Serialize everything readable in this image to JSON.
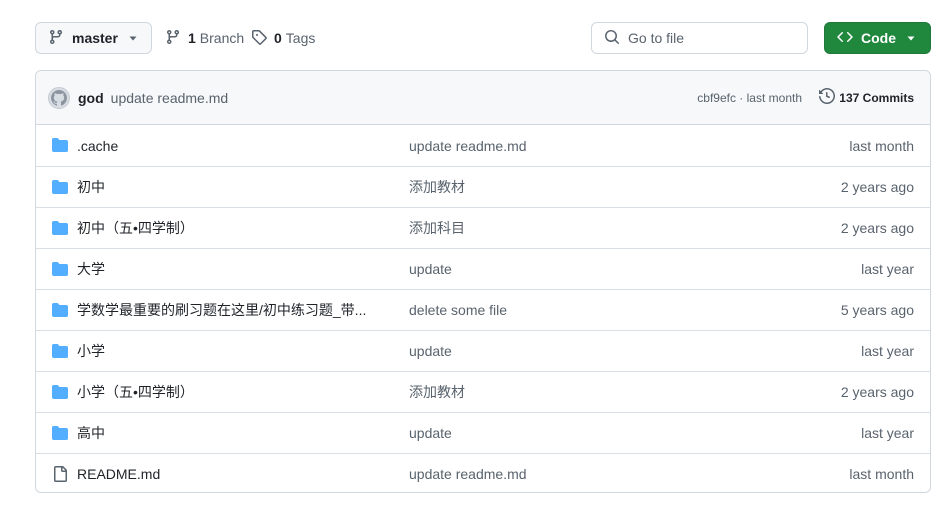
{
  "toolbar": {
    "branch_label": "master",
    "branches_count": "1",
    "branches_label": "Branch",
    "tags_count": "0",
    "tags_label": "Tags",
    "search_placeholder": "Go to file",
    "code_label": "Code"
  },
  "commit": {
    "author": "god",
    "message": "update readme.md",
    "meta": "cbf9efc · last month",
    "commits_label": "137 Commits"
  },
  "files": [
    {
      "name": ".cache",
      "type": "folder",
      "message": "update readme.md",
      "age": "last month"
    },
    {
      "name": "初中",
      "type": "folder",
      "message": "添加教材",
      "age": "2 years ago"
    },
    {
      "name": "初中（五•四学制）",
      "type": "folder",
      "message": "添加科目",
      "age": "2 years ago"
    },
    {
      "name": "大学",
      "type": "folder",
      "message": "update",
      "age": "last year"
    },
    {
      "name": "学数学最重要的刷习题在这里/初中练习题_带...",
      "type": "folder",
      "message": "delete some file",
      "age": "5 years ago"
    },
    {
      "name": "小学",
      "type": "folder",
      "message": "update",
      "age": "last year"
    },
    {
      "name": "小学（五•四学制）",
      "type": "folder",
      "message": "添加教材",
      "age": "2 years ago"
    },
    {
      "name": "高中",
      "type": "folder",
      "message": "update",
      "age": "last year"
    },
    {
      "name": "README.md",
      "type": "file",
      "message": "update readme.md",
      "age": "last month"
    }
  ],
  "colors": {
    "accent_green": "#1f883d",
    "folder_blue": "#54aeff",
    "muted_text": "#59636e",
    "border": "#d0d7de"
  },
  "icons": {
    "branch": "git-branch-icon",
    "tag": "tag-icon",
    "search": "search-icon",
    "code": "code-icon",
    "history": "history-icon",
    "folder": "folder-icon",
    "file": "file-icon"
  }
}
